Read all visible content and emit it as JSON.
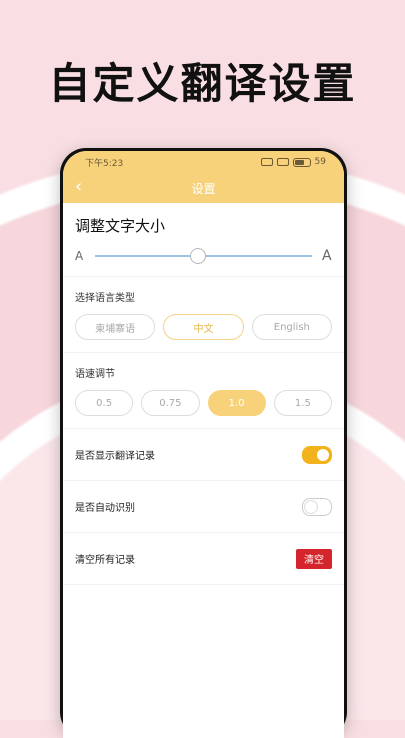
{
  "hero": {
    "title": "自定义翻译设置"
  },
  "status_bar": {
    "time": "下午5:23",
    "battery": "59"
  },
  "header": {
    "title": "设置",
    "back_icon": "chevron-left-icon"
  },
  "font_size": {
    "title": "调整文字大小",
    "small_label": "A",
    "large_label": "A",
    "value_percent": 44
  },
  "language": {
    "label": "选择语言类型",
    "options": [
      "柬埔寨语",
      "中文",
      "English"
    ],
    "selected": "中文"
  },
  "speed": {
    "label": "语速调节",
    "options": [
      "0.5",
      "0.75",
      "1.0",
      "1.5"
    ],
    "selected": "1.0"
  },
  "settings": {
    "show_history": {
      "label": "是否显示翻译记录",
      "on": true
    },
    "auto_detect": {
      "label": "是否自动识别",
      "on": false
    },
    "clear_all": {
      "label": "清空所有记录",
      "button": "清空"
    }
  },
  "colors": {
    "accent": "#f7d27a",
    "toggle_on": "#f2b21b",
    "danger": "#d4252c"
  }
}
